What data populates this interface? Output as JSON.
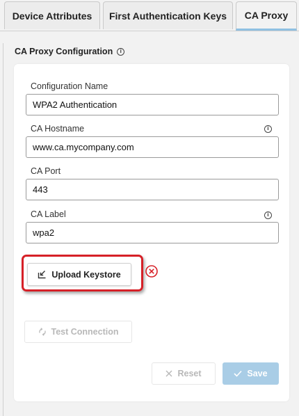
{
  "tabs": [
    {
      "label": "Device Attributes",
      "active": false
    },
    {
      "label": "First Authentication Keys",
      "active": false
    },
    {
      "label": "CA Proxy",
      "active": true
    }
  ],
  "section": {
    "title": "CA Proxy Configuration"
  },
  "form": {
    "config_name": {
      "label": "Configuration Name",
      "value": "WPA2 Authentication"
    },
    "ca_hostname": {
      "label": "CA Hostname",
      "value": "www.ca.mycompany.com"
    },
    "ca_port": {
      "label": "CA Port",
      "value": "443"
    },
    "ca_label": {
      "label": "CA Label",
      "value": "wpa2"
    }
  },
  "buttons": {
    "upload_keystore": "Upload Keystore",
    "test_connection": "Test Connection",
    "reset": "Reset",
    "save": "Save"
  },
  "colors": {
    "highlight": "#d62027",
    "error": "#d62027",
    "primary_disabled": "#a9cde6",
    "active_tab_underline": "#8fc0e2"
  },
  "icons": {
    "info": "info-icon",
    "upload": "upload-icon",
    "error": "error-circle-x-icon",
    "test": "refresh-icon",
    "reset": "close-icon",
    "save": "check-icon"
  }
}
